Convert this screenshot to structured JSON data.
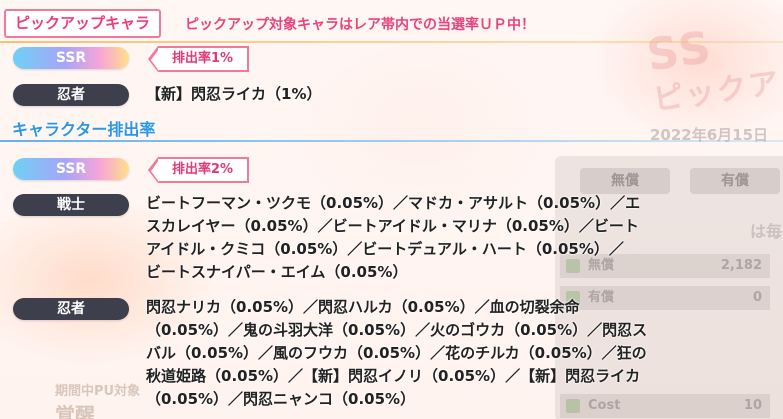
{
  "header": {
    "title": "ピックアップキャラ",
    "note": "ピックアップ対象キャラはレア帯内での当選率ＵＰ中！"
  },
  "pickup": {
    "rarity": "SSR",
    "rate": "排出率1%",
    "class": "忍者",
    "entry": "【新】閃忍ライカ（1%）"
  },
  "section": {
    "title": "キャラクター排出率"
  },
  "rates": {
    "rarity": "SSR",
    "rate": "排出率2%",
    "groups": [
      {
        "class": "戦士",
        "text": "ビートフーマン・ツクモ（0.05%）／マドカ・アサルト（0.05%）／エ\nスカレイヤー（0.05%）／ビートアイドル・マリナ（0.05%）／ビート\nアイドル・クミコ（0.05%）／ビートデュアル・ハート（0.05%）／\nビートスナイパー・エイム（0.05%）"
      },
      {
        "class": "忍者",
        "text": "閃忍ナリカ（0.05%）／閃忍ハルカ（0.05%）／血の切裂余命\n（0.05%）／鬼の斗羽大洋（0.05%）／火のゴウカ（0.05%）／閃忍ス\nバル（0.05%）／風のフウカ（0.05%）／花のチルカ（0.05%）／狂の\n秋道姫路（0.05%）／【新】閃忍イノリ（0.05%）／【新】閃忍ライカ\n（0.05%）／閃忍ニャンコ（0.05%）"
      }
    ]
  },
  "background": {
    "banner_line1": "SS",
    "banner_line2": "ピックア",
    "date": "2022年6月15日",
    "tab_free": "無償",
    "tab_paid": "有償",
    "side_text": "は毎",
    "row_free_label": "無償",
    "row_free_value": "2,182",
    "row_paid_label": "有償",
    "row_paid_value": "0",
    "row_cost_label": "Cost",
    "row_cost_value": "10",
    "bottom_line1": "期間中PU対象",
    "bottom_line2": "覚醒"
  },
  "colors": {
    "accent_pink": "#f03c78",
    "section_blue": "#2a96e6",
    "class_pill": "#3e3f4c"
  }
}
